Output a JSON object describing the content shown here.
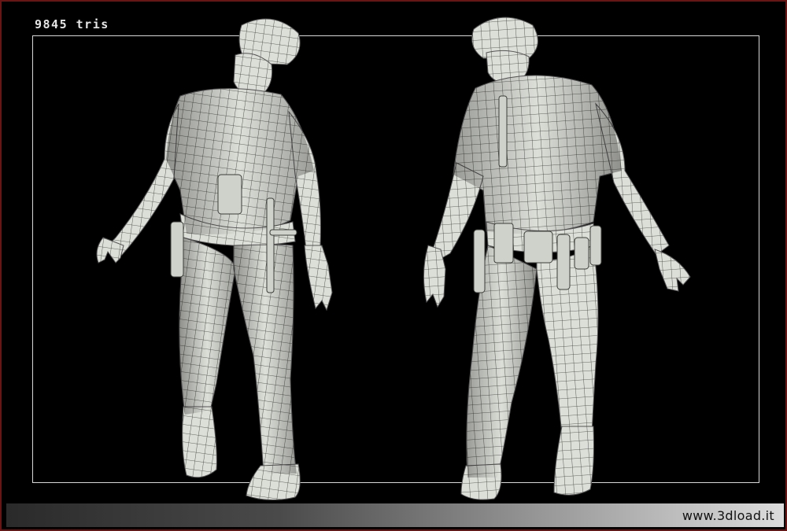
{
  "header": {
    "tri_count": "9845 tris"
  },
  "footer": {
    "website": "www.3dload.it"
  },
  "views": [
    {
      "name": "front-view"
    },
    {
      "name": "back-view"
    }
  ],
  "colors": {
    "background": "#000000",
    "frame_border": "#6a1414",
    "model_surface": "#dcded8",
    "wire": "#3b3d38"
  }
}
